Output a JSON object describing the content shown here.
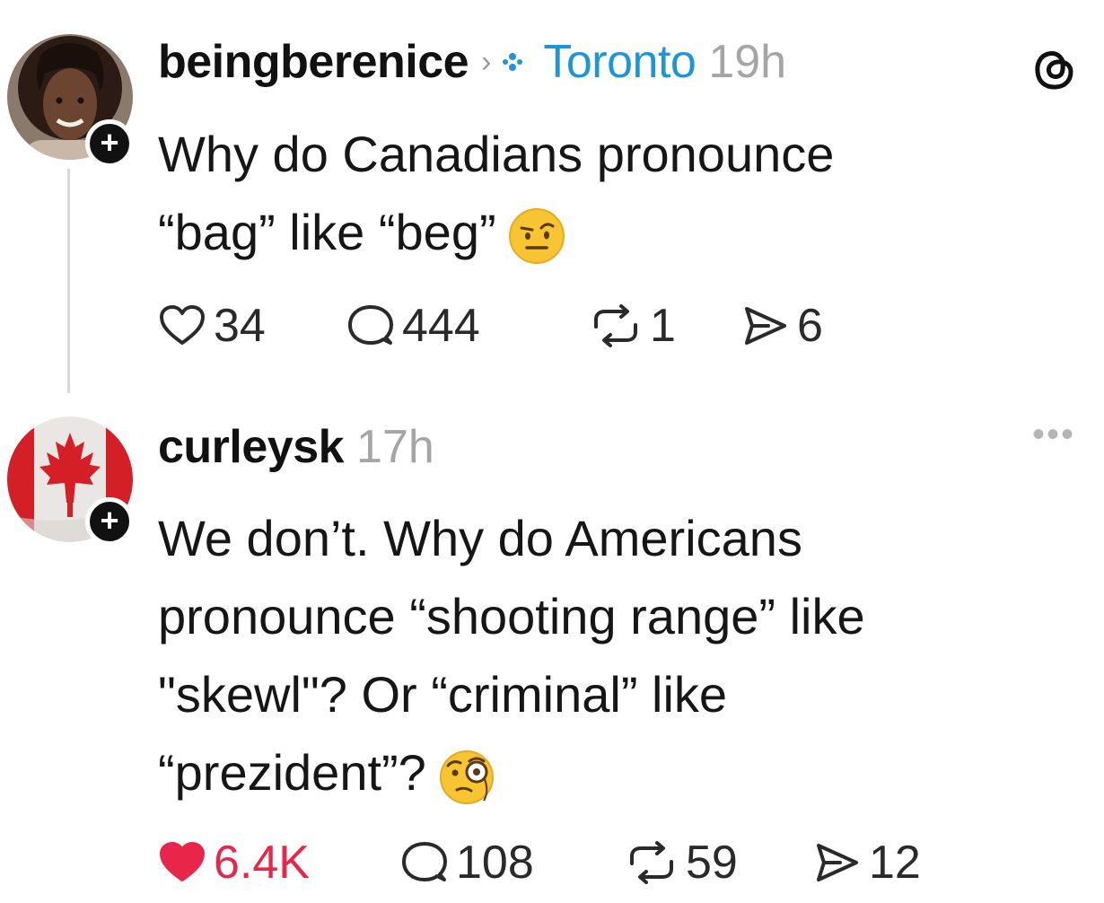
{
  "posts": [
    {
      "username": "beingberenice",
      "location": "Toronto",
      "time": "19h",
      "text_lines": [
        "Why do Canadians pronounce",
        "“bag” like “beg”"
      ],
      "emoji": "raised-eyebrow-face",
      "likes": "34",
      "liked": false,
      "replies": "444",
      "reposts": "1",
      "shares": "6"
    },
    {
      "username": "curleysk",
      "time": "17h",
      "text_lines": [
        "We don’t. Why do Americans",
        "pronounce “shooting range” like",
        "\"skewl\"? Or “criminal” like",
        "“prezident”?"
      ],
      "emoji": "face-with-monocle",
      "likes": "6.4K",
      "liked": true,
      "replies": "108",
      "reposts": "59",
      "shares": "12"
    }
  ],
  "colors": {
    "location": "#1d96d8",
    "liked": "#e8264a",
    "muted": "#a5a5a5"
  },
  "icons": [
    "threads-logo-icon",
    "more-icon",
    "heart-icon",
    "reply-icon",
    "repost-icon",
    "share-icon",
    "plus-icon",
    "location-icon"
  ]
}
